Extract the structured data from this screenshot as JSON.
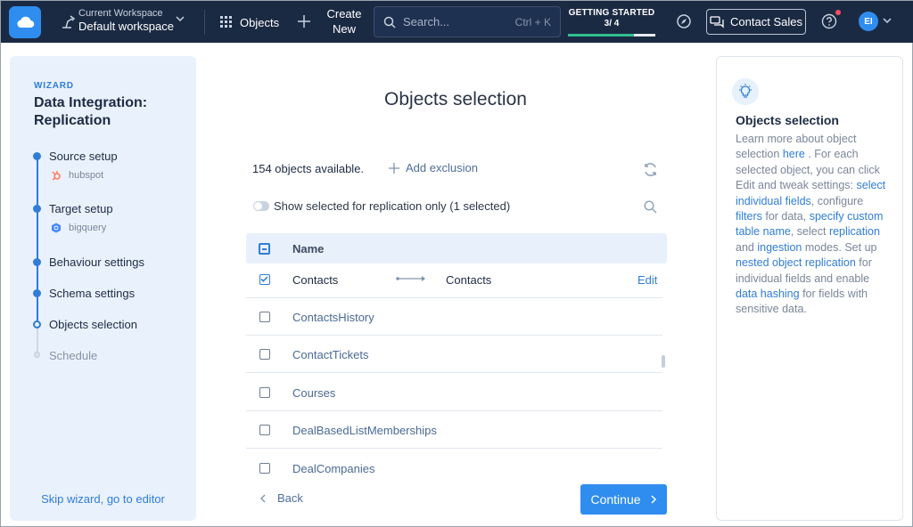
{
  "topbar": {
    "workspace_label": "Current Workspace",
    "workspace_name": "Default workspace",
    "objects_label": "Objects",
    "create_line1": "Create",
    "create_line2": "New",
    "search_placeholder": "Search...",
    "search_shortcut": "Ctrl + K",
    "getting_started_title": "GETTING STARTED",
    "getting_started_count": "3/ 4",
    "getting_started_progress": 0.75,
    "contact_sales": "Contact Sales",
    "avatar_initials": "EI",
    "accent_color": "#2f8df0"
  },
  "wizard": {
    "label": "WIZARD",
    "title": "Data Integration: Replication",
    "steps": [
      {
        "label": "Source setup",
        "sub": "hubspot"
      },
      {
        "label": "Target setup",
        "sub": "bigquery"
      },
      {
        "label": "Behaviour settings"
      },
      {
        "label": "Schema settings"
      },
      {
        "label": "Objects selection"
      },
      {
        "label": "Schedule"
      }
    ],
    "skip_label": "Skip wizard, go to editor"
  },
  "main": {
    "title": "Objects selection",
    "available_text": "154 objects available.",
    "add_exclusion": "Add exclusion",
    "toggle_label": "Show selected for replication only (1 selected)",
    "column_name": "Name",
    "rows": [
      {
        "name": "Contacts",
        "target": "Contacts",
        "action": "Edit",
        "checked": true
      },
      {
        "name": "ContactsHistory",
        "checked": false
      },
      {
        "name": "ContactTickets",
        "checked": false
      },
      {
        "name": "Courses",
        "checked": false
      },
      {
        "name": "DealBasedListMemberships",
        "checked": false
      },
      {
        "name": "DealCompanies",
        "checked": false
      }
    ],
    "back_label": "Back",
    "continue_label": "Continue"
  },
  "help": {
    "title": "Objects selection",
    "t1": "Learn more about object selection ",
    "l1": "here",
    "t2": " . For each selected object, you can click Edit and tweak settings: ",
    "l2": "select individual fields",
    "t3": ", configure ",
    "l3": "filters",
    "t4": " for data, ",
    "l4": "specify custom table name",
    "t5": ", select ",
    "l5": "replication",
    "t6": " and ",
    "l6": "ingestion",
    "t7": " modes. Set up ",
    "l7": "nested object replication",
    "t8": " for individual fields and enable ",
    "l8": "data hashing",
    "t9": " for fields with sensitive data."
  }
}
